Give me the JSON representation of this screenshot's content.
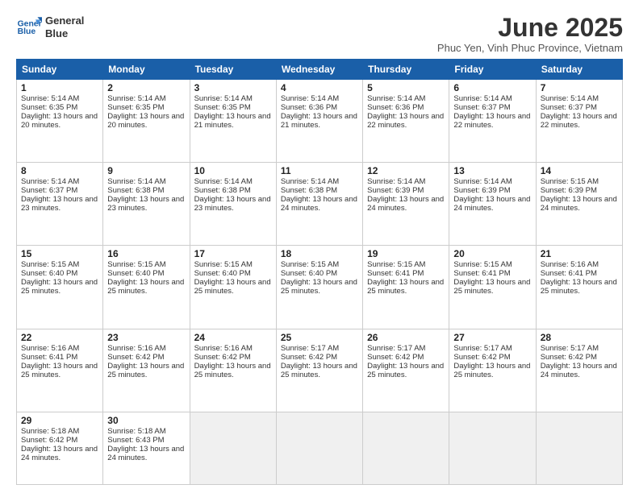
{
  "logo": {
    "line1": "General",
    "line2": "Blue"
  },
  "header": {
    "title": "June 2025",
    "location": "Phuc Yen, Vinh Phuc Province, Vietnam"
  },
  "weekdays": [
    "Sunday",
    "Monday",
    "Tuesday",
    "Wednesday",
    "Thursday",
    "Friday",
    "Saturday"
  ],
  "weeks": [
    [
      {
        "day": 1,
        "sunrise": "5:14 AM",
        "sunset": "6:35 PM",
        "daylight": "13 hours and 20 minutes."
      },
      {
        "day": 2,
        "sunrise": "5:14 AM",
        "sunset": "6:35 PM",
        "daylight": "13 hours and 20 minutes."
      },
      {
        "day": 3,
        "sunrise": "5:14 AM",
        "sunset": "6:35 PM",
        "daylight": "13 hours and 21 minutes."
      },
      {
        "day": 4,
        "sunrise": "5:14 AM",
        "sunset": "6:36 PM",
        "daylight": "13 hours and 21 minutes."
      },
      {
        "day": 5,
        "sunrise": "5:14 AM",
        "sunset": "6:36 PM",
        "daylight": "13 hours and 22 minutes."
      },
      {
        "day": 6,
        "sunrise": "5:14 AM",
        "sunset": "6:37 PM",
        "daylight": "13 hours and 22 minutes."
      },
      {
        "day": 7,
        "sunrise": "5:14 AM",
        "sunset": "6:37 PM",
        "daylight": "13 hours and 22 minutes."
      }
    ],
    [
      {
        "day": 8,
        "sunrise": "5:14 AM",
        "sunset": "6:37 PM",
        "daylight": "13 hours and 23 minutes."
      },
      {
        "day": 9,
        "sunrise": "5:14 AM",
        "sunset": "6:38 PM",
        "daylight": "13 hours and 23 minutes."
      },
      {
        "day": 10,
        "sunrise": "5:14 AM",
        "sunset": "6:38 PM",
        "daylight": "13 hours and 23 minutes."
      },
      {
        "day": 11,
        "sunrise": "5:14 AM",
        "sunset": "6:38 PM",
        "daylight": "13 hours and 24 minutes."
      },
      {
        "day": 12,
        "sunrise": "5:14 AM",
        "sunset": "6:39 PM",
        "daylight": "13 hours and 24 minutes."
      },
      {
        "day": 13,
        "sunrise": "5:14 AM",
        "sunset": "6:39 PM",
        "daylight": "13 hours and 24 minutes."
      },
      {
        "day": 14,
        "sunrise": "5:15 AM",
        "sunset": "6:39 PM",
        "daylight": "13 hours and 24 minutes."
      }
    ],
    [
      {
        "day": 15,
        "sunrise": "5:15 AM",
        "sunset": "6:40 PM",
        "daylight": "13 hours and 25 minutes."
      },
      {
        "day": 16,
        "sunrise": "5:15 AM",
        "sunset": "6:40 PM",
        "daylight": "13 hours and 25 minutes."
      },
      {
        "day": 17,
        "sunrise": "5:15 AM",
        "sunset": "6:40 PM",
        "daylight": "13 hours and 25 minutes."
      },
      {
        "day": 18,
        "sunrise": "5:15 AM",
        "sunset": "6:40 PM",
        "daylight": "13 hours and 25 minutes."
      },
      {
        "day": 19,
        "sunrise": "5:15 AM",
        "sunset": "6:41 PM",
        "daylight": "13 hours and 25 minutes."
      },
      {
        "day": 20,
        "sunrise": "5:15 AM",
        "sunset": "6:41 PM",
        "daylight": "13 hours and 25 minutes."
      },
      {
        "day": 21,
        "sunrise": "5:16 AM",
        "sunset": "6:41 PM",
        "daylight": "13 hours and 25 minutes."
      }
    ],
    [
      {
        "day": 22,
        "sunrise": "5:16 AM",
        "sunset": "6:41 PM",
        "daylight": "13 hours and 25 minutes."
      },
      {
        "day": 23,
        "sunrise": "5:16 AM",
        "sunset": "6:42 PM",
        "daylight": "13 hours and 25 minutes."
      },
      {
        "day": 24,
        "sunrise": "5:16 AM",
        "sunset": "6:42 PM",
        "daylight": "13 hours and 25 minutes."
      },
      {
        "day": 25,
        "sunrise": "5:17 AM",
        "sunset": "6:42 PM",
        "daylight": "13 hours and 25 minutes."
      },
      {
        "day": 26,
        "sunrise": "5:17 AM",
        "sunset": "6:42 PM",
        "daylight": "13 hours and 25 minutes."
      },
      {
        "day": 27,
        "sunrise": "5:17 AM",
        "sunset": "6:42 PM",
        "daylight": "13 hours and 25 minutes."
      },
      {
        "day": 28,
        "sunrise": "5:17 AM",
        "sunset": "6:42 PM",
        "daylight": "13 hours and 24 minutes."
      }
    ],
    [
      {
        "day": 29,
        "sunrise": "5:18 AM",
        "sunset": "6:42 PM",
        "daylight": "13 hours and 24 minutes."
      },
      {
        "day": 30,
        "sunrise": "5:18 AM",
        "sunset": "6:43 PM",
        "daylight": "13 hours and 24 minutes."
      },
      null,
      null,
      null,
      null,
      null
    ]
  ]
}
